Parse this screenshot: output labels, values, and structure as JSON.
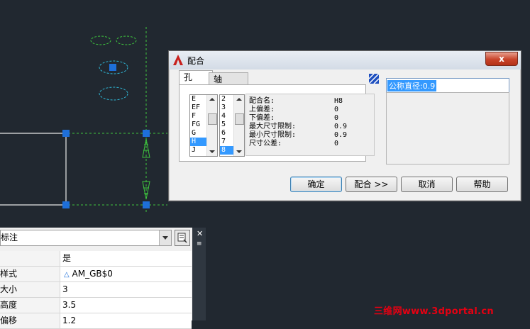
{
  "dialog": {
    "title": "配合",
    "close_label": "x",
    "tabs": [
      {
        "label": "孔"
      },
      {
        "label": "轴"
      }
    ],
    "hole_letters": [
      "E",
      "EF",
      "F",
      "FG",
      "G",
      "H",
      "J"
    ],
    "selected_letter": "H",
    "grade_numbers": [
      "2",
      "3",
      "4",
      "5",
      "6",
      "7",
      "8"
    ],
    "selected_grade": "8",
    "info": [
      {
        "label": "配合名:",
        "value": "H8"
      },
      {
        "label": "上偏差:",
        "value": "0"
      },
      {
        "label": "下偏差:",
        "value": "0"
      },
      {
        "label": "最大尺寸限制:",
        "value": "0.9"
      },
      {
        "label": "最小尺寸限制:",
        "value": "0.9"
      },
      {
        "label": "尺寸公差:",
        "value": "0"
      }
    ],
    "tolerance_text": "公称直径:0.9",
    "buttons": {
      "ok": "确定",
      "fit": "配合 >>",
      "cancel": "取消",
      "help": "帮助"
    }
  },
  "properties": {
    "combo_value": "标注",
    "rows": [
      {
        "key": "",
        "value": "是"
      },
      {
        "key": "样式",
        "value": "AM_GB$0"
      },
      {
        "key": "大小",
        "value": "3"
      },
      {
        "key": "高度",
        "value": "3.5"
      },
      {
        "key": "偏移",
        "value": "1.2"
      }
    ]
  },
  "watermark": "三维网www.3dportal.cn",
  "colors": {
    "canvas": "#212830",
    "grip": "#1e6fd9",
    "green_dash": "#3ec43e",
    "cyan_dash": "#2fb7d6"
  }
}
